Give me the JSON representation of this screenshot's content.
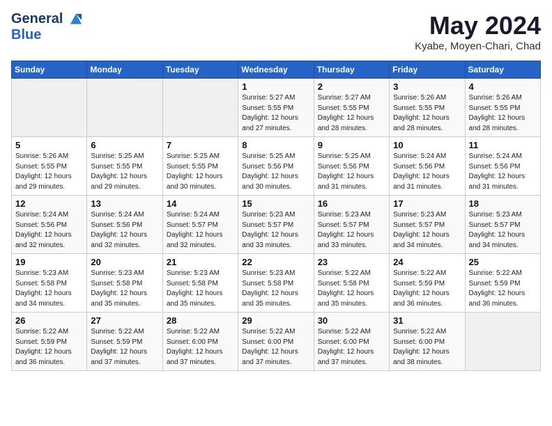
{
  "header": {
    "logo_line1": "General",
    "logo_line2": "Blue",
    "main_title": "May 2024",
    "subtitle": "Kyabe, Moyen-Chari, Chad"
  },
  "days_of_week": [
    "Sunday",
    "Monday",
    "Tuesday",
    "Wednesday",
    "Thursday",
    "Friday",
    "Saturday"
  ],
  "weeks": [
    [
      {
        "day": "",
        "sunrise": "",
        "sunset": "",
        "daylight": ""
      },
      {
        "day": "",
        "sunrise": "",
        "sunset": "",
        "daylight": ""
      },
      {
        "day": "",
        "sunrise": "",
        "sunset": "",
        "daylight": ""
      },
      {
        "day": "1",
        "sunrise": "Sunrise: 5:27 AM",
        "sunset": "Sunset: 5:55 PM",
        "daylight": "Daylight: 12 hours and 27 minutes."
      },
      {
        "day": "2",
        "sunrise": "Sunrise: 5:27 AM",
        "sunset": "Sunset: 5:55 PM",
        "daylight": "Daylight: 12 hours and 28 minutes."
      },
      {
        "day": "3",
        "sunrise": "Sunrise: 5:26 AM",
        "sunset": "Sunset: 5:55 PM",
        "daylight": "Daylight: 12 hours and 28 minutes."
      },
      {
        "day": "4",
        "sunrise": "Sunrise: 5:26 AM",
        "sunset": "Sunset: 5:55 PM",
        "daylight": "Daylight: 12 hours and 28 minutes."
      }
    ],
    [
      {
        "day": "5",
        "sunrise": "Sunrise: 5:26 AM",
        "sunset": "Sunset: 5:55 PM",
        "daylight": "Daylight: 12 hours and 29 minutes."
      },
      {
        "day": "6",
        "sunrise": "Sunrise: 5:25 AM",
        "sunset": "Sunset: 5:55 PM",
        "daylight": "Daylight: 12 hours and 29 minutes."
      },
      {
        "day": "7",
        "sunrise": "Sunrise: 5:25 AM",
        "sunset": "Sunset: 5:55 PM",
        "daylight": "Daylight: 12 hours and 30 minutes."
      },
      {
        "day": "8",
        "sunrise": "Sunrise: 5:25 AM",
        "sunset": "Sunset: 5:56 PM",
        "daylight": "Daylight: 12 hours and 30 minutes."
      },
      {
        "day": "9",
        "sunrise": "Sunrise: 5:25 AM",
        "sunset": "Sunset: 5:56 PM",
        "daylight": "Daylight: 12 hours and 31 minutes."
      },
      {
        "day": "10",
        "sunrise": "Sunrise: 5:24 AM",
        "sunset": "Sunset: 5:56 PM",
        "daylight": "Daylight: 12 hours and 31 minutes."
      },
      {
        "day": "11",
        "sunrise": "Sunrise: 5:24 AM",
        "sunset": "Sunset: 5:56 PM",
        "daylight": "Daylight: 12 hours and 31 minutes."
      }
    ],
    [
      {
        "day": "12",
        "sunrise": "Sunrise: 5:24 AM",
        "sunset": "Sunset: 5:56 PM",
        "daylight": "Daylight: 12 hours and 32 minutes."
      },
      {
        "day": "13",
        "sunrise": "Sunrise: 5:24 AM",
        "sunset": "Sunset: 5:56 PM",
        "daylight": "Daylight: 12 hours and 32 minutes."
      },
      {
        "day": "14",
        "sunrise": "Sunrise: 5:24 AM",
        "sunset": "Sunset: 5:57 PM",
        "daylight": "Daylight: 12 hours and 32 minutes."
      },
      {
        "day": "15",
        "sunrise": "Sunrise: 5:23 AM",
        "sunset": "Sunset: 5:57 PM",
        "daylight": "Daylight: 12 hours and 33 minutes."
      },
      {
        "day": "16",
        "sunrise": "Sunrise: 5:23 AM",
        "sunset": "Sunset: 5:57 PM",
        "daylight": "Daylight: 12 hours and 33 minutes."
      },
      {
        "day": "17",
        "sunrise": "Sunrise: 5:23 AM",
        "sunset": "Sunset: 5:57 PM",
        "daylight": "Daylight: 12 hours and 34 minutes."
      },
      {
        "day": "18",
        "sunrise": "Sunrise: 5:23 AM",
        "sunset": "Sunset: 5:57 PM",
        "daylight": "Daylight: 12 hours and 34 minutes."
      }
    ],
    [
      {
        "day": "19",
        "sunrise": "Sunrise: 5:23 AM",
        "sunset": "Sunset: 5:58 PM",
        "daylight": "Daylight: 12 hours and 34 minutes."
      },
      {
        "day": "20",
        "sunrise": "Sunrise: 5:23 AM",
        "sunset": "Sunset: 5:58 PM",
        "daylight": "Daylight: 12 hours and 35 minutes."
      },
      {
        "day": "21",
        "sunrise": "Sunrise: 5:23 AM",
        "sunset": "Sunset: 5:58 PM",
        "daylight": "Daylight: 12 hours and 35 minutes."
      },
      {
        "day": "22",
        "sunrise": "Sunrise: 5:23 AM",
        "sunset": "Sunset: 5:58 PM",
        "daylight": "Daylight: 12 hours and 35 minutes."
      },
      {
        "day": "23",
        "sunrise": "Sunrise: 5:22 AM",
        "sunset": "Sunset: 5:58 PM",
        "daylight": "Daylight: 12 hours and 35 minutes."
      },
      {
        "day": "24",
        "sunrise": "Sunrise: 5:22 AM",
        "sunset": "Sunset: 5:59 PM",
        "daylight": "Daylight: 12 hours and 36 minutes."
      },
      {
        "day": "25",
        "sunrise": "Sunrise: 5:22 AM",
        "sunset": "Sunset: 5:59 PM",
        "daylight": "Daylight: 12 hours and 36 minutes."
      }
    ],
    [
      {
        "day": "26",
        "sunrise": "Sunrise: 5:22 AM",
        "sunset": "Sunset: 5:59 PM",
        "daylight": "Daylight: 12 hours and 36 minutes."
      },
      {
        "day": "27",
        "sunrise": "Sunrise: 5:22 AM",
        "sunset": "Sunset: 5:59 PM",
        "daylight": "Daylight: 12 hours and 37 minutes."
      },
      {
        "day": "28",
        "sunrise": "Sunrise: 5:22 AM",
        "sunset": "Sunset: 6:00 PM",
        "daylight": "Daylight: 12 hours and 37 minutes."
      },
      {
        "day": "29",
        "sunrise": "Sunrise: 5:22 AM",
        "sunset": "Sunset: 6:00 PM",
        "daylight": "Daylight: 12 hours and 37 minutes."
      },
      {
        "day": "30",
        "sunrise": "Sunrise: 5:22 AM",
        "sunset": "Sunset: 6:00 PM",
        "daylight": "Daylight: 12 hours and 37 minutes."
      },
      {
        "day": "31",
        "sunrise": "Sunrise: 5:22 AM",
        "sunset": "Sunset: 6:00 PM",
        "daylight": "Daylight: 12 hours and 38 minutes."
      },
      {
        "day": "",
        "sunrise": "",
        "sunset": "",
        "daylight": ""
      }
    ]
  ]
}
